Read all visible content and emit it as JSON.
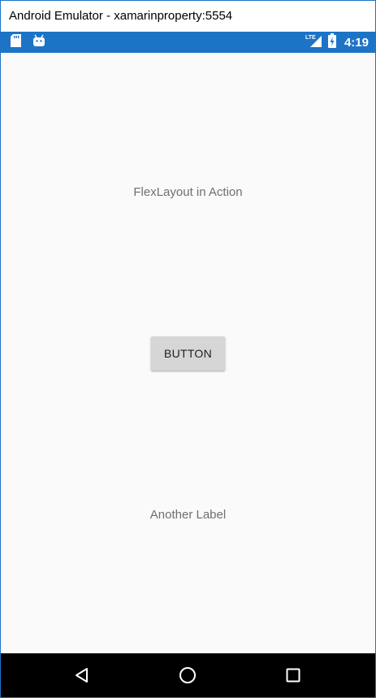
{
  "window": {
    "title": "Android Emulator - xamarinproperty:5554"
  },
  "status_bar": {
    "left_icons": [
      "sd-card-icon",
      "android-icon"
    ],
    "network_label": "LTE",
    "signal_icon": "signal-icon",
    "battery_icon": "battery-charging-icon",
    "time": "4:19",
    "background_color": "#1d74c7"
  },
  "main": {
    "label_top": "FlexLayout in Action",
    "button_label": "BUTTON",
    "label_bottom": "Another Label",
    "background_color": "#fafafa"
  },
  "nav_bar": {
    "buttons": [
      "back-icon",
      "home-icon",
      "recents-icon"
    ]
  }
}
